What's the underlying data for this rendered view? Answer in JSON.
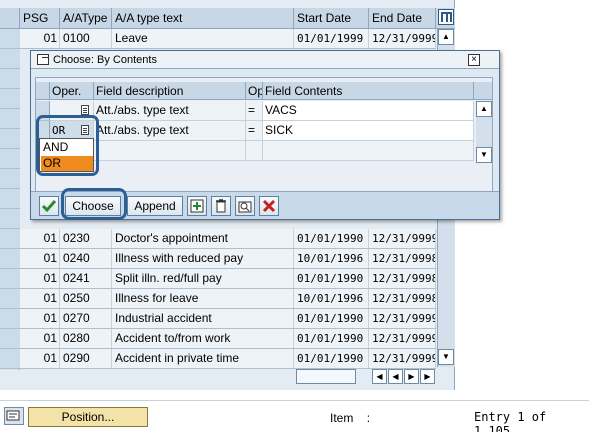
{
  "table": {
    "headers": [
      "PSG",
      "A/AType",
      "A/A type text",
      "Start Date",
      "End Date"
    ],
    "rows": [
      {
        "psg": "01",
        "type": "0100",
        "text": "Leave",
        "start": "01/01/1999",
        "end": "12/31/9999"
      },
      {
        "psg": "01",
        "type": "0230",
        "text": "Doctor's appointment",
        "start": "01/01/1990",
        "end": "12/31/9999"
      },
      {
        "psg": "01",
        "type": "0240",
        "text": "Illness with reduced pay",
        "start": "10/01/1996",
        "end": "12/31/9998"
      },
      {
        "psg": "01",
        "type": "0241",
        "text": "Split illn. red/full pay",
        "start": "01/01/1990",
        "end": "12/31/9998"
      },
      {
        "psg": "01",
        "type": "0250",
        "text": "Illness for leave",
        "start": "10/01/1996",
        "end": "12/31/9998"
      },
      {
        "psg": "01",
        "type": "0270",
        "text": "Industrial accident",
        "start": "01/01/1990",
        "end": "12/31/9999"
      },
      {
        "psg": "01",
        "type": "0280",
        "text": "Accident to/from work",
        "start": "01/01/1990",
        "end": "12/31/9999"
      },
      {
        "psg": "01",
        "type": "0290",
        "text": "Accident in private time",
        "start": "01/01/1990",
        "end": "12/31/9999"
      }
    ]
  },
  "dialog": {
    "title": "Choose: By Contents",
    "headers": [
      "Oper.",
      "Field description",
      "Op",
      "Field Contents"
    ],
    "rows": [
      {
        "oper": "",
        "field": "Att./abs. type text",
        "op": "=",
        "contents": "VACS"
      },
      {
        "oper": "OR",
        "field": "Att./abs. type text",
        "op": "=",
        "contents": "SICK"
      }
    ],
    "dropdown_options": [
      "AND",
      "OR"
    ],
    "selected_option": "OR",
    "buttons": {
      "choose": "Choose",
      "append": "Append"
    }
  },
  "status": {
    "position_button": "Position...",
    "item_label": "Item",
    "item_sep": ":",
    "entry_text": "Entry 1 of 1,105"
  },
  "colors": {
    "accent": "#2e5f94",
    "selected_option": "#f08c1e"
  }
}
